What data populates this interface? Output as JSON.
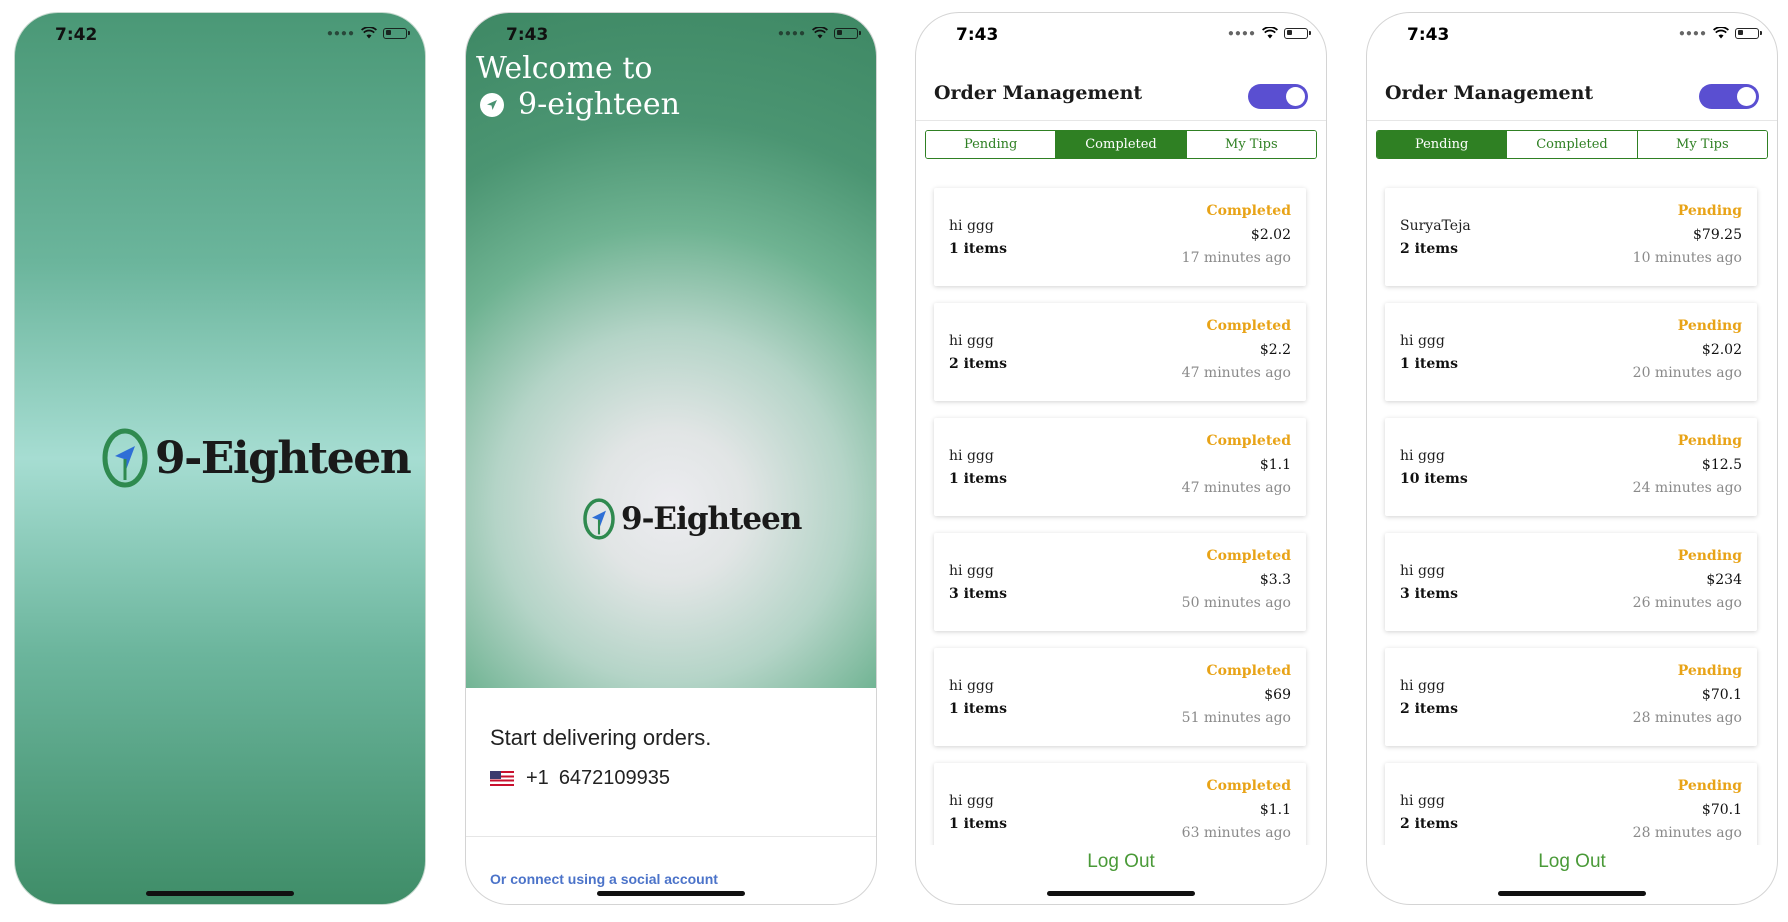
{
  "splash": {
    "status": {
      "time": "7:42"
    },
    "logo_text": "9-Eighteen"
  },
  "welcome": {
    "status": {
      "time": "7:43"
    },
    "welcome_line1": "Welcome to",
    "brand": "9-eighteen",
    "logo_text": "9-Eighteen",
    "start_text": "Start delivering orders.",
    "country_code": "+1",
    "phone_number": "6472109935",
    "social_link": "Or connect using a social account"
  },
  "orders_completed": {
    "status": {
      "time": "7:43"
    },
    "title": "Order Management",
    "tabs": [
      "Pending",
      "Completed",
      "My Tips"
    ],
    "active_tab": "Completed",
    "orders": [
      {
        "name": "hi ggg",
        "items": "1 items",
        "status": "Completed",
        "amount": "$2.02",
        "time": "17 minutes ago"
      },
      {
        "name": "hi ggg",
        "items": "2 items",
        "status": "Completed",
        "amount": "$2.2",
        "time": "47 minutes ago"
      },
      {
        "name": "hi ggg",
        "items": "1 items",
        "status": "Completed",
        "amount": "$1.1",
        "time": "47 minutes ago"
      },
      {
        "name": "hi ggg",
        "items": "3 items",
        "status": "Completed",
        "amount": "$3.3",
        "time": "50 minutes ago"
      },
      {
        "name": "hi ggg",
        "items": "1 items",
        "status": "Completed",
        "amount": "$69",
        "time": "51 minutes ago"
      },
      {
        "name": "hi ggg",
        "items": "1 items",
        "status": "Completed",
        "amount": "$1.1",
        "time": "63 minutes ago"
      }
    ],
    "logout": "Log Out"
  },
  "orders_pending": {
    "status": {
      "time": "7:43"
    },
    "title": "Order Management",
    "tabs": [
      "Pending",
      "Completed",
      "My Tips"
    ],
    "active_tab": "Pending",
    "orders": [
      {
        "name": "SuryaTeja",
        "items": "2 items",
        "status": "Pending",
        "amount": "$79.25",
        "time": "10 minutes ago"
      },
      {
        "name": "hi ggg",
        "items": "1 items",
        "status": "Pending",
        "amount": "$2.02",
        "time": "20 minutes ago"
      },
      {
        "name": "hi ggg",
        "items": "10 items",
        "status": "Pending",
        "amount": "$12.5",
        "time": "24 minutes ago"
      },
      {
        "name": "hi ggg",
        "items": "3 items",
        "status": "Pending",
        "amount": "$234",
        "time": "26 minutes ago"
      },
      {
        "name": "hi ggg",
        "items": "2 items",
        "status": "Pending",
        "amount": "$70.1",
        "time": "28 minutes ago"
      },
      {
        "name": "hi ggg",
        "items": "2 items",
        "status": "Pending",
        "amount": "$70.1",
        "time": "28 minutes ago"
      }
    ],
    "logout": "Log Out"
  },
  "colors": {
    "brand_green": "#2f8023",
    "pending_amber": "#e8a317",
    "toggle_purple": "#5a4fd1",
    "link_blue": "#4b73c9",
    "logout_green": "#4a9a38"
  },
  "icons": [
    "wifi-icon",
    "battery-icon",
    "signal-dots-icon",
    "logo-pin-icon",
    "navigation-arrow-icon",
    "us-flag-icon"
  ]
}
